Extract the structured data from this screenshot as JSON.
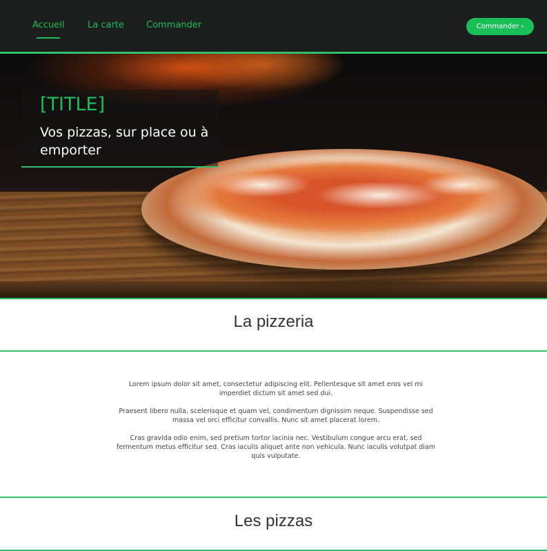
{
  "nav": {
    "links": [
      {
        "label": "Accueil",
        "active": true
      },
      {
        "label": "La carte",
        "active": false
      },
      {
        "label": "Commander",
        "active": false
      }
    ],
    "cta_label": "Commander ›",
    "accent": "#1fbd5b",
    "background": "#1c1d1d"
  },
  "hero": {
    "title": "[TITLE]",
    "subtitle": "Vos pizzas, sur place ou à emporter",
    "image": "pizza-on-wooden-board"
  },
  "sections": {
    "pizzeria": {
      "title": "La pizzeria",
      "paragraphs": [
        "Lorem ipsum dolor sit amet, consectetur adipiscing elit. Pellentesque sit amet eros vel mi imperdiet dictum sit amet sed dui.",
        "Praesent libero nulla, scelerisque et quam vel, condimentum dignissim neque. Suspendisse sed massa vel orci efficitur convallis. Nunc sit amet placerat lorem.",
        "Cras gravida odio enim, sed pretium tortor lacinia nec. Vestibulum congue arcu erat, sed fermentum metus efficitur sed. Cras iaculis aliquet ante non vehicula. Nunc iaculis volutpat diam quis vulputate."
      ]
    },
    "pizzas": {
      "title": "Les pizzas"
    }
  }
}
